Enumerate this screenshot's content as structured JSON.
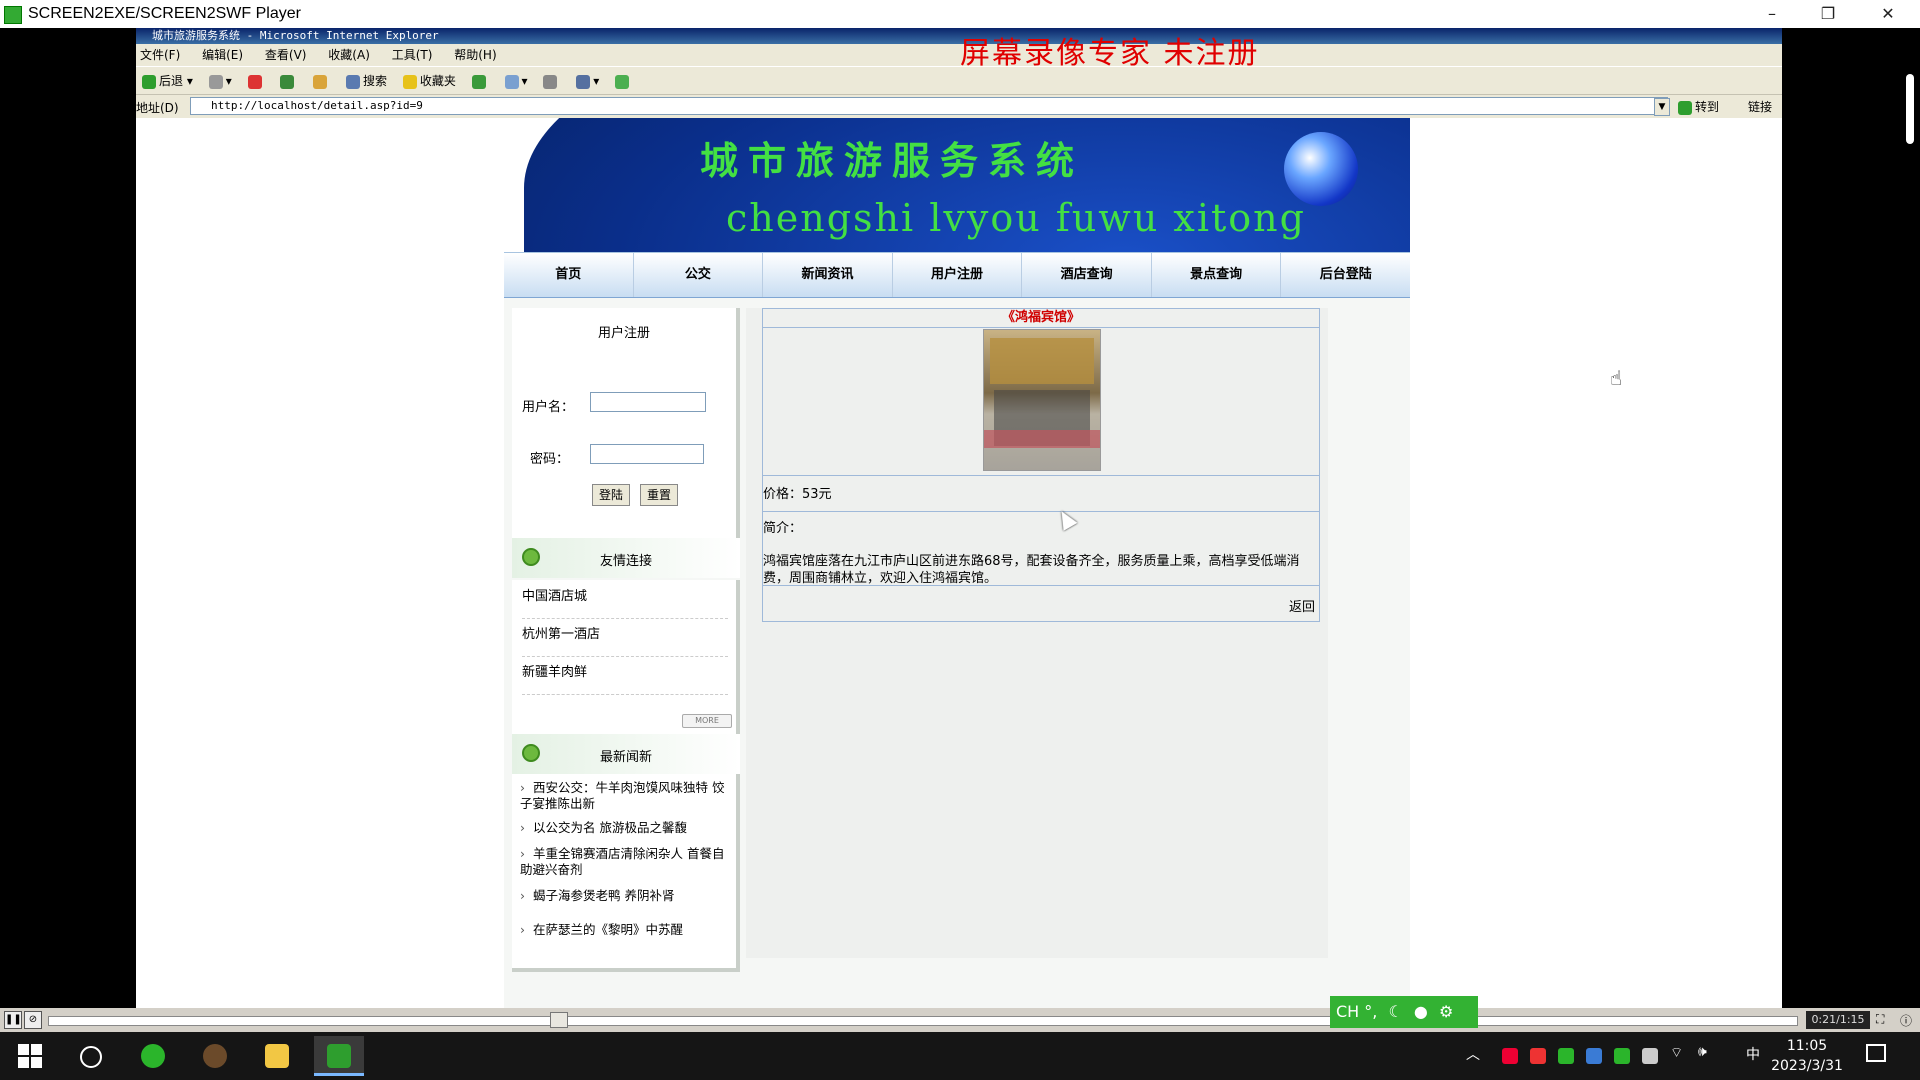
{
  "player": {
    "title": "SCREEN2EXE/SCREEN2SWF Player",
    "minimize": "–",
    "restore": "❐",
    "close": "✕",
    "time": "0:21/1:15"
  },
  "ie": {
    "window_title": "城市旅游服务系统 - Microsoft Internet Explorer",
    "watermark": "屏幕录像专家 未注册",
    "menu": [
      "文件(F)",
      "编辑(E)",
      "查看(V)",
      "收藏(A)",
      "工具(T)",
      "帮助(H)"
    ],
    "toolbar": {
      "back": "后退",
      "search": "搜索",
      "favorites": "收藏夹"
    },
    "address_label": "地址(D)",
    "address_url": "http://localhost/detail.asp?id=9",
    "go_label": "转到",
    "links_label": "链接"
  },
  "site": {
    "title": "城市旅游服务系统",
    "subtitle": "chengshi lvyou fuwu xitong",
    "nav": [
      "首页",
      "公交",
      "新闻资讯",
      "用户注册",
      "酒店查询",
      "景点查询",
      "后台登陆"
    ]
  },
  "login": {
    "title": "用户注册",
    "username_label": "用户名：",
    "username_value": "",
    "password_label": "密码：",
    "password_value": "",
    "login_button": "登陆",
    "reset_button": "重置"
  },
  "links": {
    "title": "友情连接",
    "items": [
      "中国酒店城",
      "杭州第一酒店",
      "新疆羊肉鲜"
    ],
    "more": "MORE"
  },
  "news": {
    "title": "最新闻新",
    "items": [
      "西安公交：牛羊肉泡馍风味独特 饺子宴推陈出新",
      "以公交为名 旅游极品之馨馥",
      "羊重全锦赛酒店清除闲杂人 首餐自助避兴奋剂",
      "蝎子海参煲老鸭 养阴补肾",
      "在萨瑟兰的《黎明》中苏醒"
    ]
  },
  "detail": {
    "name": "《鸿福宾馆》",
    "price": "价格：53元",
    "intro_label": "简介：",
    "intro": "鸿福宾馆座落在九江市庐山区前进东路68号，配套设备齐全，服务质量上乘，高档享受低端消费，周围商铺林立，欢迎入住鸿福宾馆。",
    "back": "返回"
  },
  "ime": {
    "label": "CH °,"
  },
  "taskbar": {
    "time": "11:05",
    "date": "2023/3/31",
    "ime_indicator": "中"
  },
  "colors": {
    "nav_gradient_bottom": "#c8ddf2",
    "detail_title": "#d00000",
    "banner_text": "#43e043",
    "watermark": "#e00000"
  }
}
